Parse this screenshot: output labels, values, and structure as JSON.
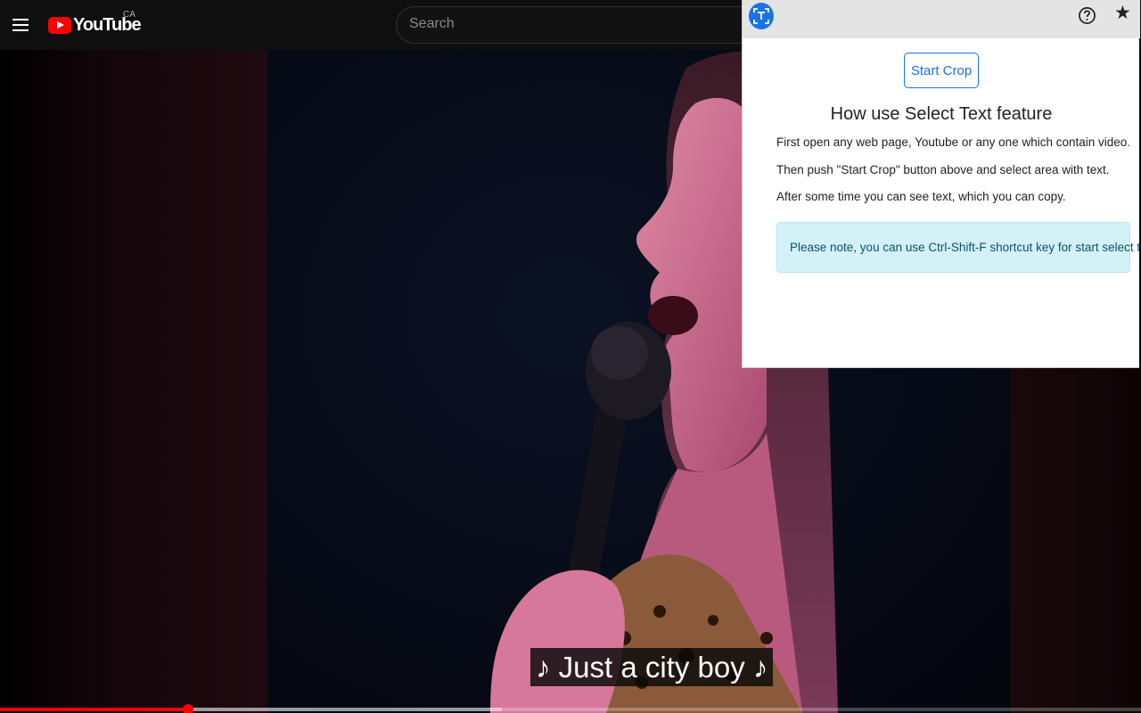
{
  "youtube": {
    "logo_text": "YouTube",
    "country_code": "CA",
    "search_placeholder": "Search"
  },
  "video": {
    "caption": "♪ Just a city boy ♪",
    "progress_percent": 16.5,
    "buffer_percent": 44
  },
  "extension_popup": {
    "start_crop_label": "Start Crop",
    "title": "How use Select Text feature",
    "instructions": [
      "First open any web page, Youtube or any one which contain video.",
      "Then push \"Start Crop\" button above and select area with text.",
      "After some time you can see text, which you can copy."
    ],
    "note": "Please note, you can use Ctrl-Shift-F shortcut key for start select text.",
    "help_icon": "help-circle-icon",
    "pin_icon": "star-icon"
  },
  "colors": {
    "accent": "#1a73e8",
    "youtube_red": "#ff0000",
    "note_background": "#d4f1f8",
    "note_text": "#0d5363"
  }
}
